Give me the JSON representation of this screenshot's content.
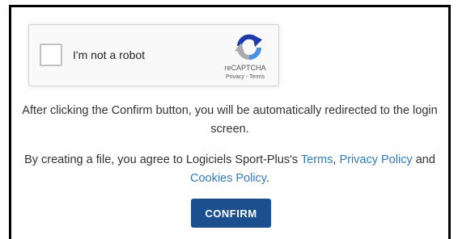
{
  "recaptcha": {
    "checkbox_label": "I'm not a robot",
    "brand": "reCAPTCHA",
    "privacy_link": "Privacy",
    "separator": " - ",
    "terms_link": "Terms"
  },
  "redirect_notice": "After clicking the Confirm button, you will be automatically redirected to the login screen.",
  "agreement": {
    "prefix": "By creating a file, you agree to Logiciels Sport-Plus's ",
    "terms_link": "Terms",
    "comma": ", ",
    "privacy_link": "Privacy Policy",
    "and_text": " and ",
    "cookies_link": "Cookies Policy",
    "suffix": "."
  },
  "confirm_button": "CONFIRM",
  "colors": {
    "link": "#2f7bbf",
    "button": "#1b4f8e",
    "recaptcha_blue": "#4a90e2",
    "recaptcha_dark": "#1c3aa9",
    "recaptcha_gray": "#ababab"
  },
  "icons": {
    "recaptcha": "recaptcha-logo-icon"
  }
}
